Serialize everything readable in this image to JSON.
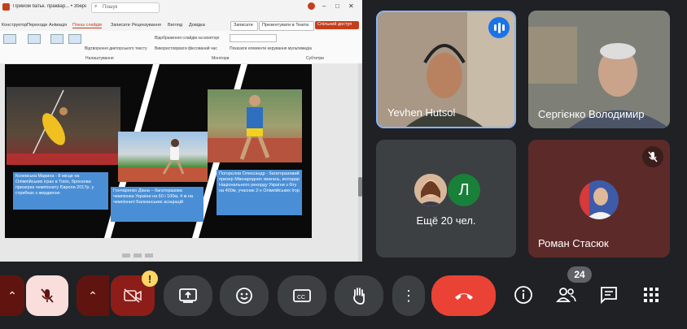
{
  "window": {
    "title": "Прийом батьк. праквар... • Збережено у ПК",
    "search_placeholder": "Пошук",
    "comments_label": "Записати",
    "present_label": "Презентувати в Teams",
    "share_label": "Спільний доступ"
  },
  "ribbon": {
    "tabs": [
      "Конструктор",
      "Переходи",
      "Анімація",
      "Показ слайдів",
      "Записати",
      "Рецензування",
      "Вигляд",
      "Довідка"
    ],
    "active_tab": "Показ слайдів",
    "rows": [
      "Відтворення дикторського тексту",
      "Відображення слайдів на моніторі",
      "Використовувати фіксований час",
      "Показати елементи керування мультимедіа"
    ],
    "groups": [
      "Налаштування",
      "Монітори",
      "Субтитри"
    ]
  },
  "slide": {
    "captions": [
      "Кохевська Марина - 8 місце на Олімпійських іграх в Токіо, бронзова призерка чемпіонату Європи 2017р. у стрибках з жердиною",
      "Гончаренко Діана – багаторазова чемпіонка України на 60 і 100м, 4 м на чемпіонаті Балканських асоціацій",
      "Погорєлов Олександр - багаторазовий призер Міжнародних змагань, володар Національного рекорду України з бігу на 400м, учасник 2-х Олімпійських Ігор"
    ]
  },
  "participants": [
    {
      "name": "Yevhen Hutsol",
      "speaking": true
    },
    {
      "name": "Сергієнко Володимир",
      "speaking": false
    },
    {
      "name": "Роман Стасюк",
      "muted": true
    }
  ],
  "others": {
    "label": "Ещё 20 чел.",
    "avatar_letter": "Л",
    "avatar_color": "#188038"
  },
  "controls": {
    "participant_count": "24",
    "end_call_color": "#ea4335",
    "muted_color": "#f9dedc",
    "camera_off_color": "#8c1d18"
  }
}
